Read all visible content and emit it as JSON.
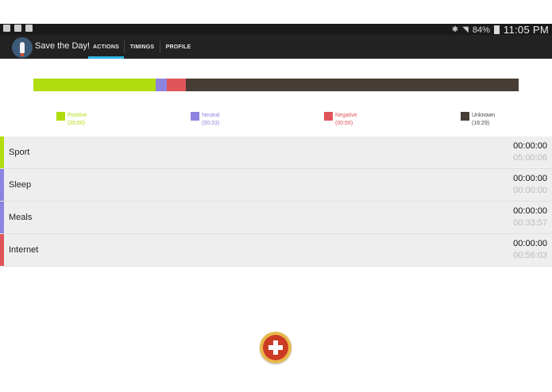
{
  "status_bar": {
    "battery": "84%",
    "time": "11:05 PM",
    "icons": [
      "phone-icon",
      "camera-icon",
      "play-icon",
      "bluetooth-icon",
      "wifi-icon",
      "battery-icon"
    ]
  },
  "app": {
    "title": "Save the Day!",
    "logo_icon": "rocket-icon"
  },
  "tabs": [
    {
      "label": "ACTIONS",
      "active": true
    },
    {
      "label": "TIMINGS",
      "active": false
    },
    {
      "label": "PROFILE",
      "active": false
    }
  ],
  "colors": {
    "positive": "#b0dd10",
    "neutral": "#8d84df",
    "negative": "#e0555a",
    "unknown": "#473d34",
    "accent": "#33b5e5"
  },
  "time_bar": [
    {
      "category": "positive",
      "fraction": 0.252
    },
    {
      "category": "neutral",
      "fraction": 0.023
    },
    {
      "category": "negative",
      "fraction": 0.039
    },
    {
      "category": "unknown",
      "fraction": 0.686
    }
  ],
  "legend": [
    {
      "key": "positive",
      "label": "Positive",
      "time": "(05:00)"
    },
    {
      "key": "neutral",
      "label": "Neutral",
      "time": "(00:33)"
    },
    {
      "key": "negative",
      "label": "Negative",
      "time": "(00:56)"
    },
    {
      "key": "unknown",
      "label": "Unknown",
      "time": "(16:29)"
    }
  ],
  "actions": [
    {
      "name": "Sport",
      "category": "positive",
      "current": "00:00:00",
      "total": "05:00:06"
    },
    {
      "name": "Sleep",
      "category": "neutral",
      "current": "00:00:00",
      "total": "00:00:00"
    },
    {
      "name": "Meals",
      "category": "neutral",
      "current": "00:00:00",
      "total": "00:33:57"
    },
    {
      "name": "Internet",
      "category": "negative",
      "current": "00:00:00",
      "total": "00:56:03"
    }
  ],
  "fab": {
    "icon": "plus-icon"
  }
}
